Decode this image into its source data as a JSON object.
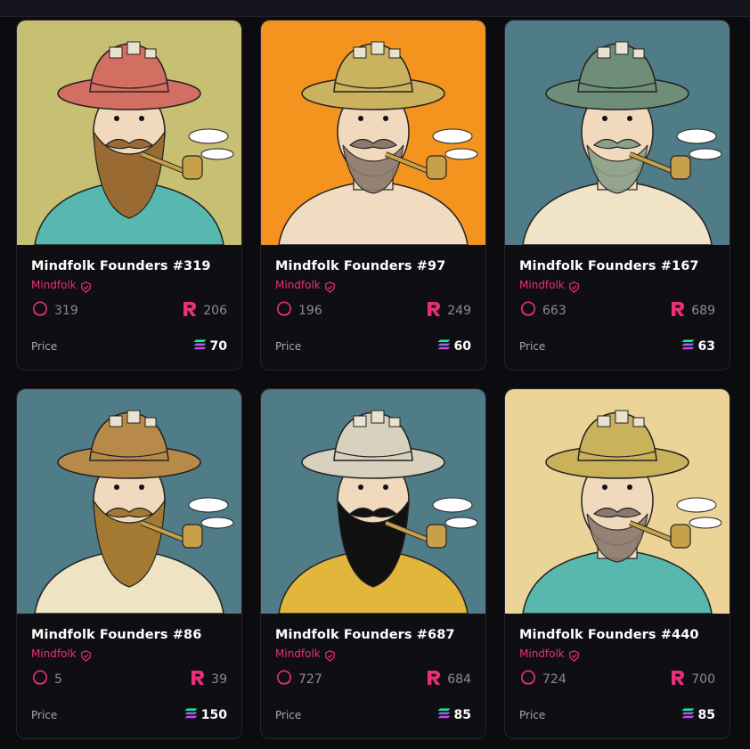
{
  "collection_name": "Mindfolk",
  "price_label": "Price",
  "colors": {
    "accent": "#e8307a",
    "background": "#0c0b10",
    "card": "#0f0e13"
  },
  "cards": [
    {
      "title": "Mindfolk Founders #319",
      "collection": "Mindfolk",
      "rarity": "319",
      "rank": "206",
      "price": "70",
      "bg": "#c7bf72",
      "hat": "#d36f62",
      "hair": "#9a6a33",
      "shirt": "#56b8ae"
    },
    {
      "title": "Mindfolk Founders #97",
      "collection": "Mindfolk",
      "rarity": "196",
      "rank": "249",
      "price": "60",
      "bg": "#f4931d",
      "hat": "#cbb25f",
      "hair": "#8a7a6e",
      "shirt": "#f1dcc2"
    },
    {
      "title": "Mindfolk Founders #167",
      "collection": "Mindfolk",
      "rarity": "663",
      "rank": "689",
      "price": "63",
      "bg": "#4f7c87",
      "hat": "#6f8e7a",
      "hair": "#8c9f88",
      "shirt": "#f0e3c6"
    },
    {
      "title": "Mindfolk Founders #86",
      "collection": "Mindfolk",
      "rarity": "5",
      "rank": "39",
      "price": "150",
      "bg": "#4f7c87",
      "hat": "#b88a4a",
      "hair": "#a47a32",
      "shirt": "#eee3c2"
    },
    {
      "title": "Mindfolk Founders #687",
      "collection": "Mindfolk",
      "rarity": "727",
      "rank": "684",
      "price": "85",
      "bg": "#4f7c87",
      "hat": "#d8d1bd",
      "hair": "#111111",
      "shirt": "#e2b63a"
    },
    {
      "title": "Mindfolk Founders #440",
      "collection": "Mindfolk",
      "rarity": "724",
      "rank": "700",
      "price": "85",
      "bg": "#ecd398",
      "hat": "#c9b25a",
      "hair": "#8a7a6e",
      "shirt": "#58b8ad"
    }
  ]
}
